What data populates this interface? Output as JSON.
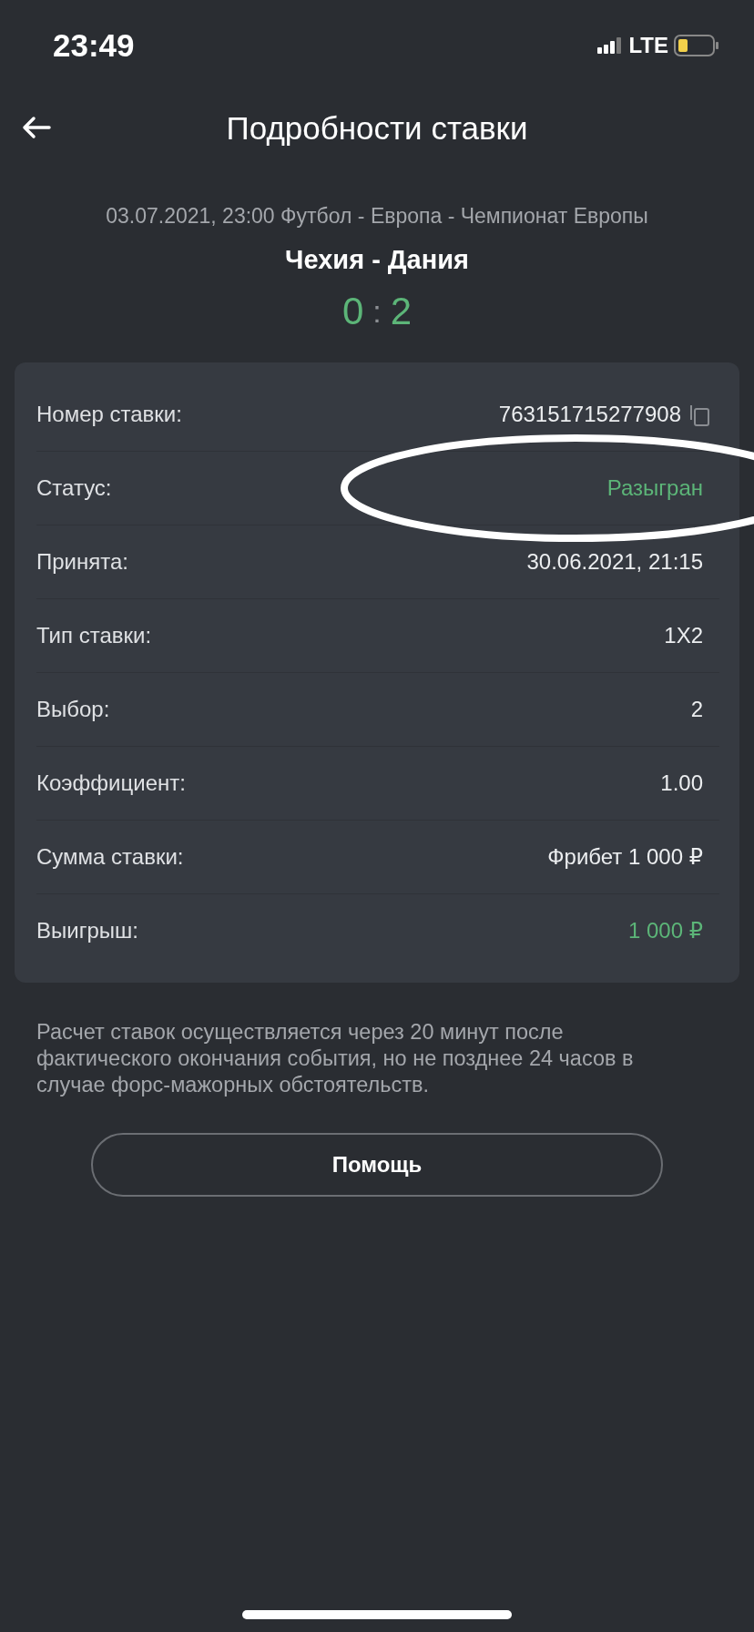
{
  "status_bar": {
    "time": "23:49",
    "network": "LTE"
  },
  "header": {
    "title": "Подробности ставки"
  },
  "event": {
    "meta": "03.07.2021, 23:00 Футбол - Европа - Чемпионат Европы",
    "teams": "Чехия - Дания",
    "score_home": "0",
    "score_separator": ":",
    "score_away": "2"
  },
  "details": [
    {
      "label": "Номер ставки:",
      "value": "763151715277908",
      "copyable": true,
      "positive": false
    },
    {
      "label": "Статус:",
      "value": "Разыгран",
      "copyable": false,
      "positive": true
    },
    {
      "label": "Принята:",
      "value": "30.06.2021, 21:15",
      "copyable": false,
      "positive": false
    },
    {
      "label": "Тип ставки:",
      "value": "1X2",
      "copyable": false,
      "positive": false
    },
    {
      "label": "Выбор:",
      "value": "2",
      "copyable": false,
      "positive": false
    },
    {
      "label": "Коэффициент:",
      "value": "1.00",
      "copyable": false,
      "positive": false
    },
    {
      "label": "Сумма ставки:",
      "value": "Фрибет 1 000 ₽",
      "copyable": false,
      "positive": false
    },
    {
      "label": "Выигрыш:",
      "value": "1 000 ₽",
      "copyable": false,
      "positive": true
    }
  ],
  "note": "Расчет ставок осуществляется через 20 минут после фактического окончания события, но не позднее 24 часов в случае форс-мажорных обстоятельств.",
  "help_button": "Помощь"
}
